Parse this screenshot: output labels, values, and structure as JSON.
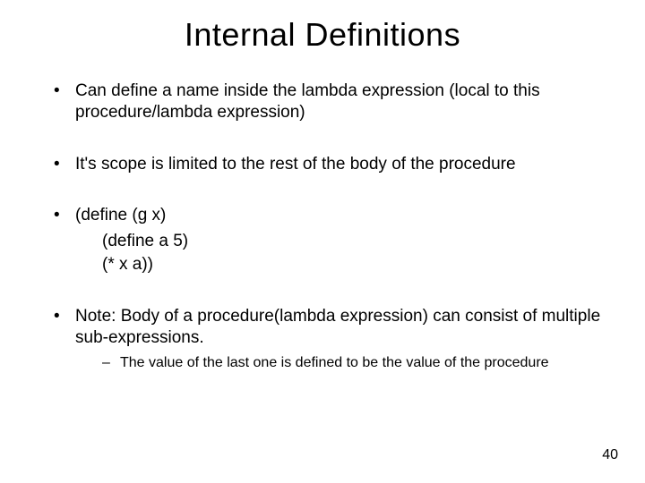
{
  "title": "Internal Definitions",
  "bullets": {
    "b1": "Can define a name inside the lambda expression (local to this procedure/lambda expression)",
    "b2": "It's scope is limited to the rest of the body of  the procedure",
    "b3": "(define (g x)",
    "b3_line2": "(define a 5)",
    "b3_line3": "(* x a))",
    "b4": "Note: Body of a procedure(lambda expression) can consist of multiple sub-expressions.",
    "b4_sub1": "The value of the last one is defined to be the value of the procedure"
  },
  "page_number": "40"
}
